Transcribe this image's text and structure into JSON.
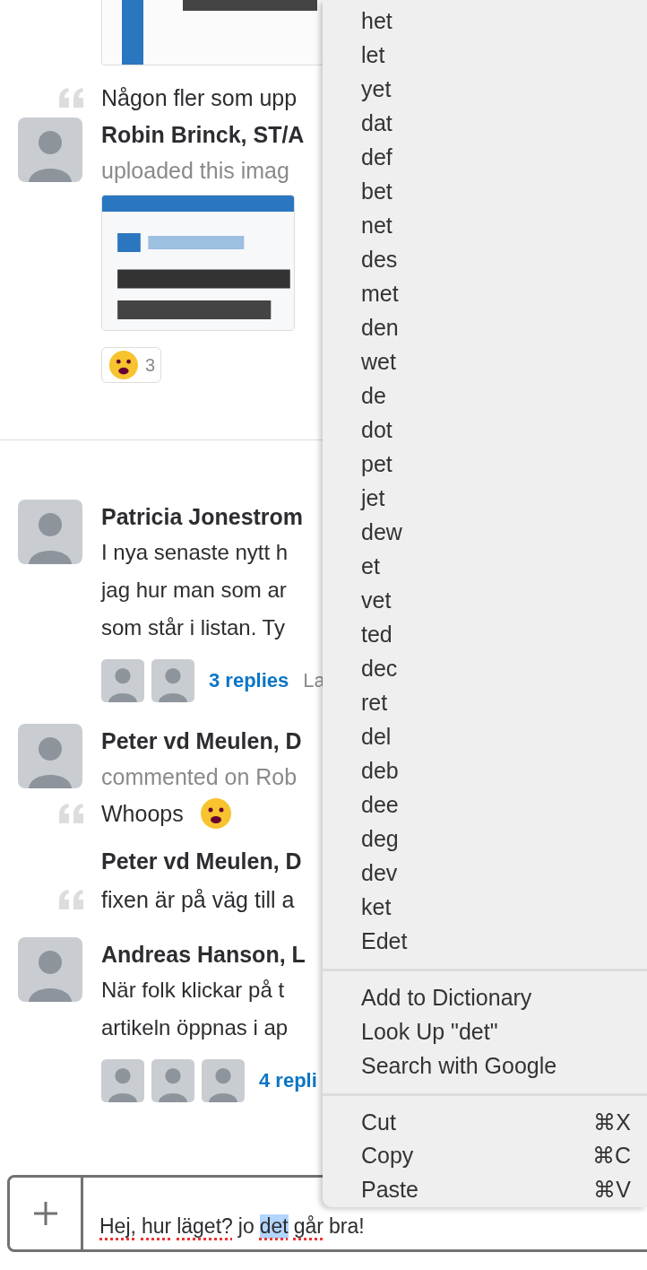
{
  "conversation": [
    {
      "kind": "picture"
    },
    {
      "kind": "quote",
      "text": "Någon fler som upp"
    },
    {
      "kind": "upload",
      "author": "Robin Brinck, ST/A",
      "action": "uploaded this imag",
      "reaction": {
        "count": "3"
      }
    },
    {
      "kind": "divider"
    },
    {
      "kind": "message",
      "author": "Patricia Jonestrom",
      "lines": [
        "I nya senaste nytt h",
        "jag hur man som ar",
        "som står i listan. Ty"
      ],
      "replies": {
        "avatars": [
          {
            "kind": "picture"
          },
          {
            "kind": "picture"
          }
        ],
        "label": "3 replies",
        "meta": "La"
      }
    },
    {
      "kind": "comment",
      "author": "Peter vd Meulen, D",
      "action": "commented on Rob",
      "quote": "Whoops"
    },
    {
      "kind": "followup",
      "author": "Peter vd Meulen, D",
      "quote": "fixen är på väg till a"
    },
    {
      "kind": "message",
      "author": "Andreas Hanson, L",
      "lines": [
        "När folk klickar på t",
        "artikeln öppnas i ap"
      ],
      "replies": {
        "avatars": [
          {
            "kind": "picture"
          },
          {
            "kind": "picture"
          },
          {
            "kind": "picture"
          }
        ],
        "label": "4 repli"
      }
    }
  ],
  "composer": {
    "words": [
      {
        "text": "Hej,",
        "misspelled": true,
        "selected": false
      },
      {
        "text": "hur",
        "misspelled": true,
        "selected": false
      },
      {
        "text": "läget?",
        "misspelled": true,
        "selected": false
      },
      {
        "text": "jo",
        "misspelled": false,
        "selected": false
      },
      {
        "text": "det",
        "misspelled": true,
        "selected": true
      },
      {
        "text": "går",
        "misspelled": true,
        "selected": false
      },
      {
        "text": "bra!",
        "misspelled": false,
        "selected": false
      }
    ]
  },
  "context_menu": {
    "groups": [
      {
        "items": [
          {
            "label": "het"
          },
          {
            "label": "let"
          },
          {
            "label": "yet"
          },
          {
            "label": "dat"
          },
          {
            "label": "def"
          },
          {
            "label": "bet"
          },
          {
            "label": "net"
          },
          {
            "label": "des"
          },
          {
            "label": "met"
          },
          {
            "label": "den"
          },
          {
            "label": "wet"
          },
          {
            "label": "de"
          },
          {
            "label": "dot"
          },
          {
            "label": "pet"
          },
          {
            "label": "jet"
          },
          {
            "label": "dew"
          },
          {
            "label": "et"
          },
          {
            "label": "vet"
          },
          {
            "label": "ted"
          },
          {
            "label": "dec"
          },
          {
            "label": "ret"
          },
          {
            "label": "del"
          },
          {
            "label": "deb"
          },
          {
            "label": "dee"
          },
          {
            "label": "deg"
          },
          {
            "label": "dev"
          },
          {
            "label": "ket"
          },
          {
            "label": "Edet"
          }
        ]
      },
      {
        "items": [
          {
            "label": "Add to Dictionary"
          },
          {
            "label": "Look Up \"det\""
          },
          {
            "label": "Search with Google"
          }
        ]
      },
      {
        "items": [
          {
            "label": "Cut",
            "shortcut": "⌘X"
          },
          {
            "label": "Copy",
            "shortcut": "⌘C"
          },
          {
            "label": "Paste",
            "shortcut": "⌘V"
          }
        ]
      }
    ]
  }
}
